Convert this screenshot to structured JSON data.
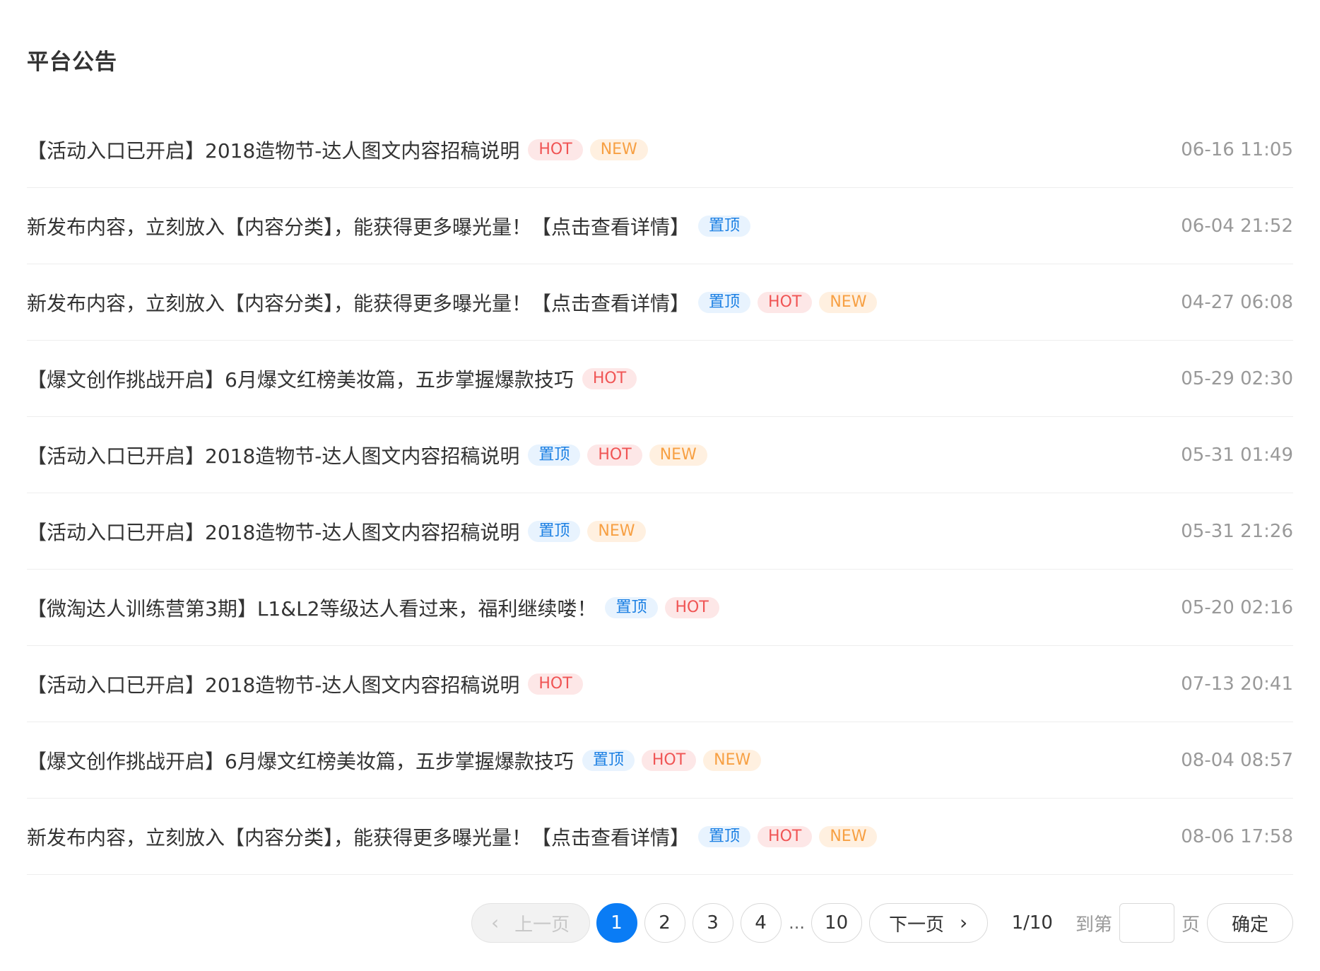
{
  "page": {
    "title": "平台公告"
  },
  "tag_labels": {
    "top": "置顶",
    "hot": "HOT",
    "new": "NEW"
  },
  "announcements": [
    {
      "title": "【活动入口已开启】2018造物节-达人图文内容招稿说明",
      "tags": [
        "hot",
        "new"
      ],
      "time": "06-16 11:05"
    },
    {
      "title": "新发布内容，立刻放入【内容分类】，能获得更多曝光量！【点击查看详情】",
      "tags": [
        "top"
      ],
      "time": "06-04 21:52"
    },
    {
      "title": "新发布内容，立刻放入【内容分类】，能获得更多曝光量！【点击查看详情】",
      "tags": [
        "top",
        "hot",
        "new"
      ],
      "time": "04-27 06:08"
    },
    {
      "title": "【爆文创作挑战开启】6月爆文红榜美妆篇，五步掌握爆款技巧",
      "tags": [
        "hot"
      ],
      "time": "05-29 02:30"
    },
    {
      "title": "【活动入口已开启】2018造物节-达人图文内容招稿说明",
      "tags": [
        "top",
        "hot",
        "new"
      ],
      "time": "05-31 01:49"
    },
    {
      "title": "【活动入口已开启】2018造物节-达人图文内容招稿说明",
      "tags": [
        "top",
        "new"
      ],
      "time": "05-31 21:26"
    },
    {
      "title": "【微淘达人训练营第3期】L1&L2等级达人看过来，福利继续喽！",
      "tags": [
        "top",
        "hot"
      ],
      "time": "05-20 02:16"
    },
    {
      "title": "【活动入口已开启】2018造物节-达人图文内容招稿说明",
      "tags": [
        "hot"
      ],
      "time": "07-13 20:41"
    },
    {
      "title": "【爆文创作挑战开启】6月爆文红榜美妆篇，五步掌握爆款技巧",
      "tags": [
        "top",
        "hot",
        "new"
      ],
      "time": "08-04 08:57"
    },
    {
      "title": "新发布内容，立刻放入【内容分类】，能获得更多曝光量！【点击查看详情】",
      "tags": [
        "top",
        "hot",
        "new"
      ],
      "time": "08-06 17:58"
    }
  ],
  "pagination": {
    "prev_label": "上一页",
    "next_label": "下一页",
    "pages": [
      "1",
      "2",
      "3",
      "4"
    ],
    "ellipsis": "...",
    "last_page": "10",
    "current_page": "1",
    "page_info": "1/10",
    "goto_label": "到第",
    "goto_value": "",
    "goto_unit": "页",
    "confirm_label": "确定"
  },
  "colors": {
    "accent": "#0a7cf5",
    "tag_top": "#1a7fe3",
    "tag_hot": "#f05454",
    "tag_new": "#f7a043"
  }
}
